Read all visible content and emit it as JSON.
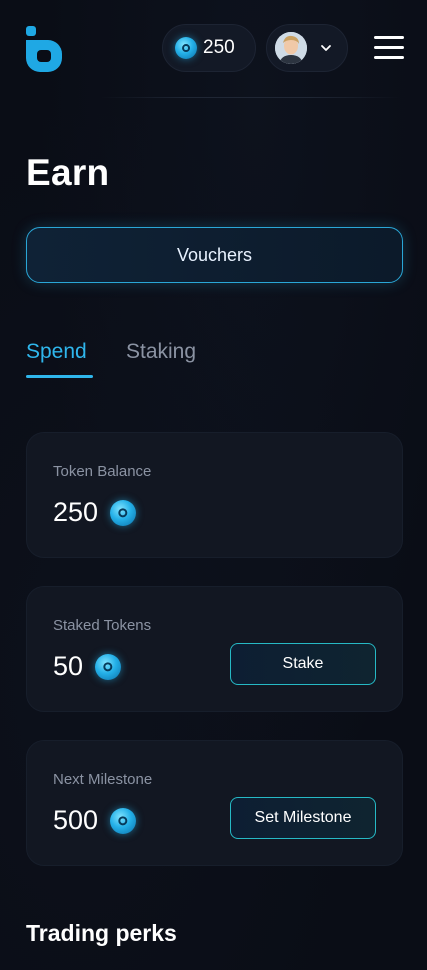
{
  "header": {
    "token_balance": "250",
    "menu_icon": "hamburger-menu-icon",
    "logo_icon": "brand-logo-icon",
    "coin_icon": "token-coin-icon"
  },
  "page": {
    "title": "Earn",
    "vouchers_label": "Vouchers"
  },
  "tabs": [
    {
      "label": "Spend",
      "active": true
    },
    {
      "label": "Staking",
      "active": false
    }
  ],
  "cards": {
    "token_balance": {
      "label": "Token Balance",
      "value": "250"
    },
    "staked_tokens": {
      "label": "Staked Tokens",
      "value": "50",
      "button": "Stake"
    },
    "next_milestone": {
      "label": "Next Milestone",
      "value": "500",
      "button": "Set Milestone"
    }
  },
  "sections": {
    "trading_perks_title": "Trading perks"
  },
  "colors": {
    "background": "#0a0d16",
    "accent": "#2fb6ec",
    "card": "#121722",
    "muted_text": "#8b93a3"
  }
}
